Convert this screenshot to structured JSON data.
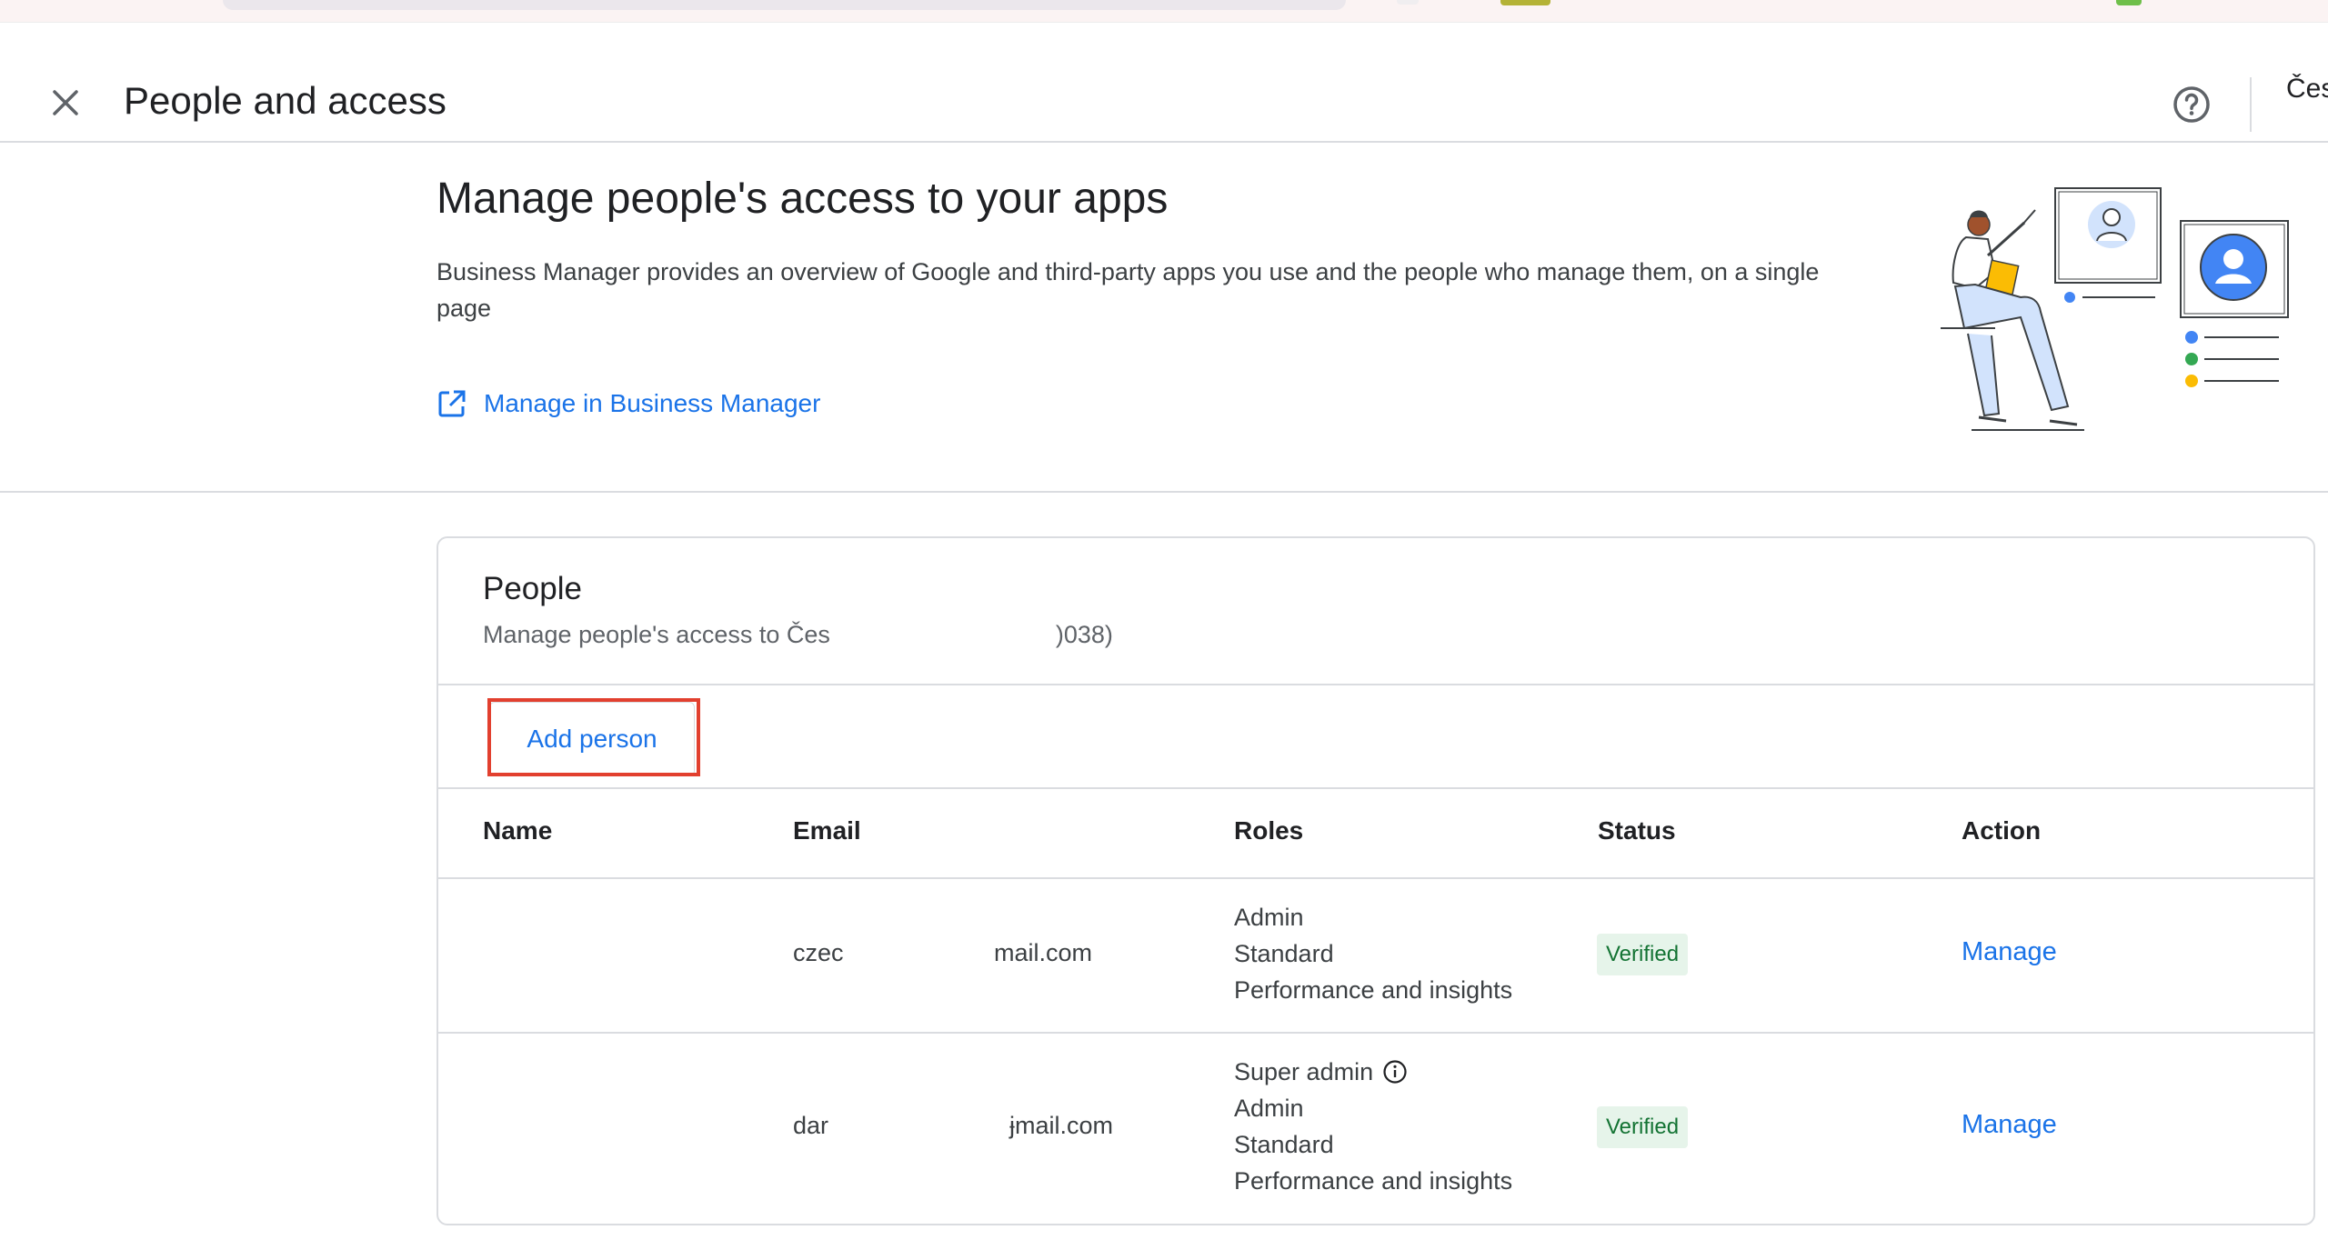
{
  "header": {
    "title": "People and access",
    "account": "Čes"
  },
  "intro": {
    "heading": "Manage people's access to your apps",
    "description": "Business Manager provides an overview of Google and third-party apps you use and the people who manage them, on a single page",
    "link_label": "Manage in Business Manager"
  },
  "people": {
    "title": "People",
    "subtitle_prefix": "Manage people's access to Čes",
    "subtitle_suffix": ")038)",
    "add_button": "Add person",
    "columns": {
      "name": "Name",
      "email": "Email",
      "roles": "Roles",
      "status": "Status",
      "action": "Action"
    },
    "rows": [
      {
        "name": "",
        "email_start": "czec",
        "email_end": "mail.com",
        "roles": [
          "Admin",
          "Standard",
          "Performance and insights"
        ],
        "status": "Verified",
        "action": "Manage"
      },
      {
        "name": "",
        "email_start": "dar",
        "email_end": "ɉmail.com",
        "roles": [
          "Super admin",
          "Admin",
          "Standard",
          "Performance and insights"
        ],
        "status": "Verified",
        "action": "Manage"
      }
    ]
  },
  "colors": {
    "link": "#1a73e8",
    "verified_bg": "#e6f4ea",
    "verified_text": "#137333",
    "highlight": "#e2402f"
  },
  "icons": {
    "close": "close-icon",
    "help": "help-circle-icon",
    "open_in_new": "open-in-new-icon",
    "info": "info-icon"
  }
}
